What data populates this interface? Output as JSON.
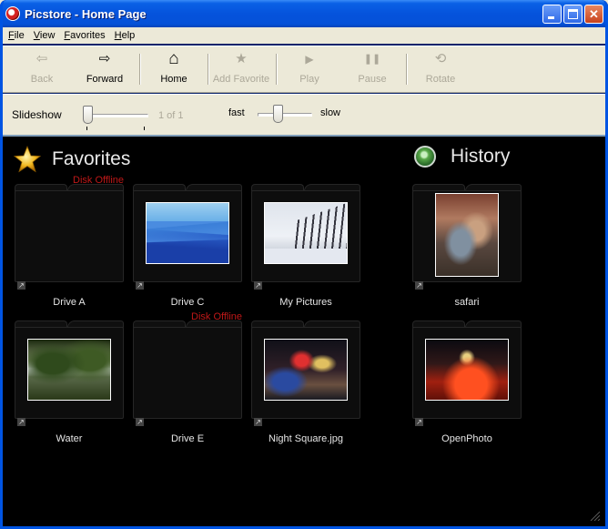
{
  "window": {
    "title": "Picstore - Home Page",
    "minimize_glyph": "",
    "maximize_glyph": "",
    "close_glyph": "✕"
  },
  "menu": {
    "items": [
      "File",
      "View",
      "Favorites",
      "Help"
    ]
  },
  "toolbar": {
    "buttons": [
      {
        "label": "Back",
        "icon": "back-arrow-icon",
        "glyph": "⇦",
        "enabled": false
      },
      {
        "label": "Forward",
        "icon": "forward-arrow-icon",
        "glyph": "⇨",
        "enabled": true
      },
      {
        "label": "Home",
        "icon": "home-icon",
        "glyph": "⌂",
        "enabled": true
      },
      {
        "label": "Add Favorite",
        "icon": "star-icon",
        "glyph": "★",
        "enabled": false
      },
      {
        "label": "Play",
        "icon": "play-icon",
        "glyph": "▶",
        "enabled": false
      },
      {
        "label": "Pause",
        "icon": "pause-icon",
        "glyph": "❚❚",
        "enabled": false
      },
      {
        "label": "Rotate",
        "icon": "rotate-icon",
        "glyph": "⟲",
        "enabled": false
      }
    ]
  },
  "slideshow": {
    "label": "Slideshow",
    "position_text": "1 of 1",
    "position_fraction": 0.0,
    "speed_fast_label": "fast",
    "speed_slow_label": "slow",
    "speed_fraction": 0.35
  },
  "favorites": {
    "title": "Favorites",
    "items": [
      {
        "label": "Drive A",
        "status": "Disk Offline",
        "thumbnail": "none"
      },
      {
        "label": "Drive C",
        "status": "",
        "thumbnail": "blue-mountains"
      },
      {
        "label": "My Pictures",
        "status": "",
        "thumbnail": "snow-fence"
      },
      {
        "label": "Water",
        "status": "",
        "thumbnail": "lake-trees"
      },
      {
        "label": "Drive E",
        "status": "Disk Offline",
        "thumbnail": "none"
      },
      {
        "label": "Night Square.jpg",
        "status": "",
        "thumbnail": "night-street"
      }
    ]
  },
  "history": {
    "title": "History",
    "items": [
      {
        "label": "safari",
        "thumbnail": "safari-people"
      },
      {
        "label": "OpenPhoto",
        "thumbnail": "night-lights"
      }
    ]
  },
  "colors": {
    "titlebar": "#0553dc",
    "chrome": "#ece9d8",
    "content_bg": "#000000",
    "offline_text": "#c01818",
    "label_text": "#e6e6e6"
  }
}
